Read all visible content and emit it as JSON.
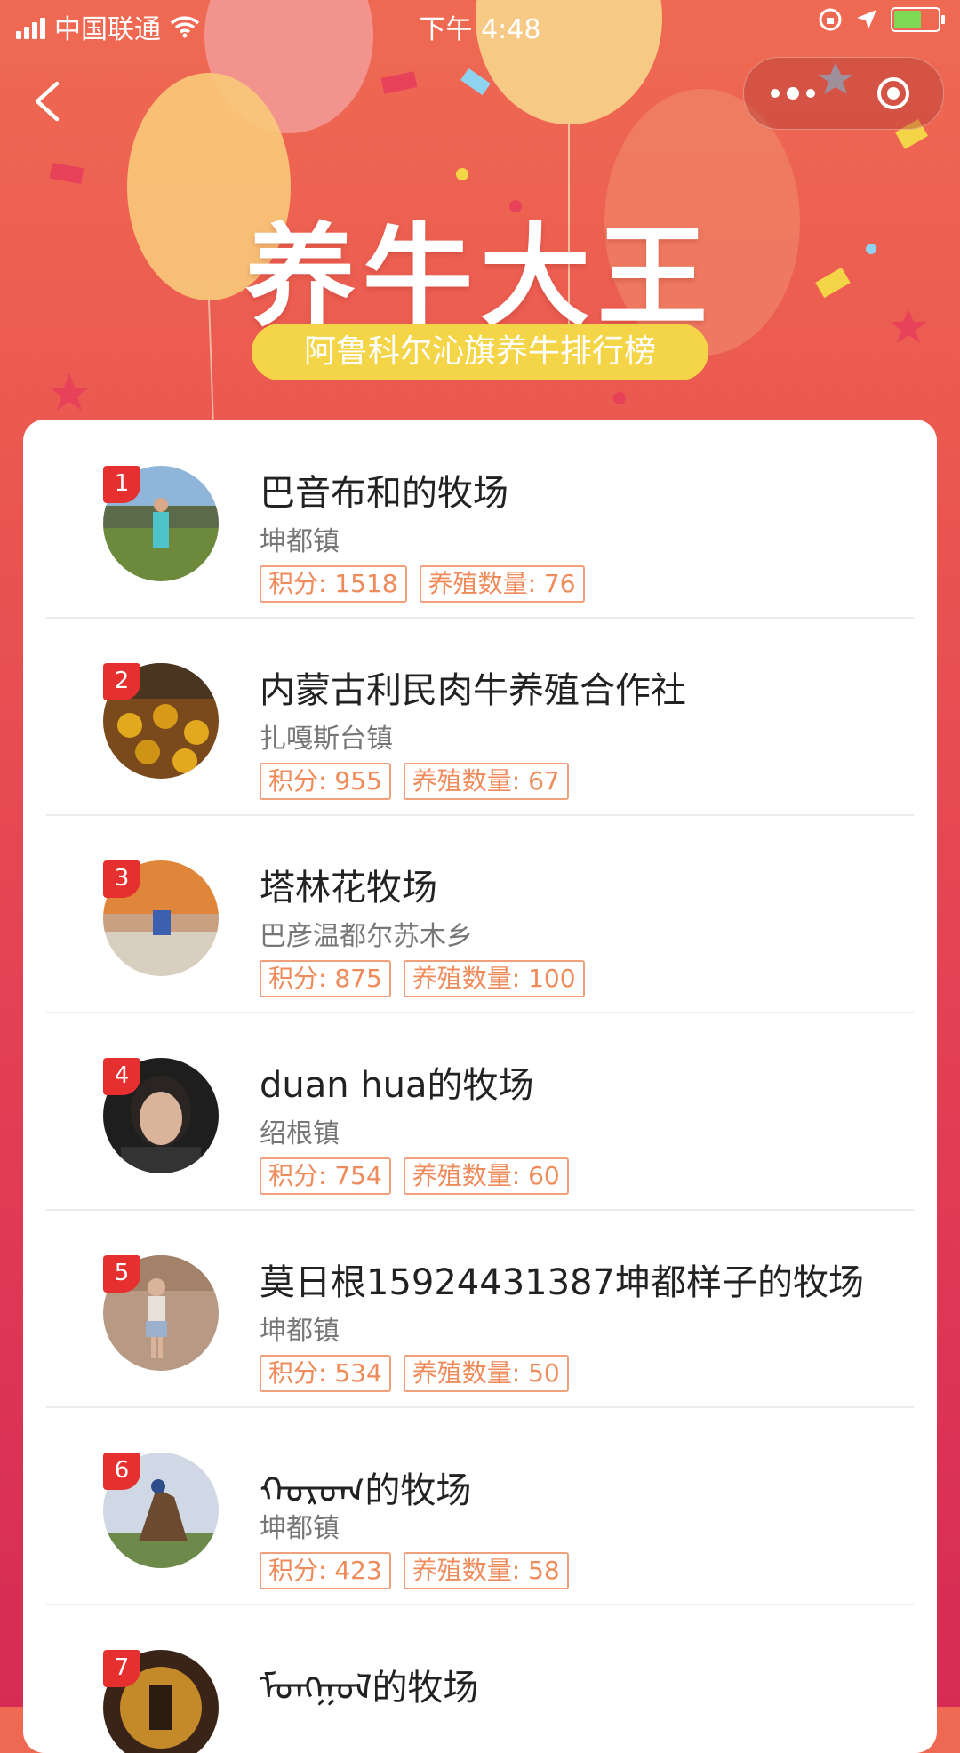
{
  "status_bar": {
    "carrier": "中国联通",
    "time": "下午 4:48"
  },
  "header": {
    "title": "养牛大王",
    "subtitle": "阿鲁科尔沁旗养牛排行榜"
  },
  "colors": {
    "primary": "#ea5550",
    "accent_yellow": "#f5d548",
    "rank_badge": "#e5302f",
    "tag_border": "#f0a07a"
  },
  "ranking": {
    "score_label": "积分",
    "count_label": "养殖数量",
    "items": [
      {
        "rank": "1",
        "name": "巴音布和的牧场",
        "town": "坤都镇",
        "score": "积分: 1518",
        "count": "养殖数量: 76"
      },
      {
        "rank": "2",
        "name": "内蒙古利民肉牛养殖合作社",
        "town": "扎嘎斯台镇",
        "score": "积分: 955",
        "count": "养殖数量: 67"
      },
      {
        "rank": "3",
        "name": "塔林花牧场",
        "town": "巴彦温都尔苏木乡",
        "score": "积分: 875",
        "count": "养殖数量: 100"
      },
      {
        "rank": "4",
        "name": "duan hua的牧场",
        "town": "绍根镇",
        "score": "积分: 754",
        "count": "养殖数量: 60"
      },
      {
        "rank": "5",
        "name": "莫日根15924431387坤都样子的牧场",
        "town": "坤都镇",
        "score": "积分: 534",
        "count": "养殖数量: 50"
      },
      {
        "rank": "6",
        "name": "ᠬᠣᠷᠣᠭ的牧场",
        "town": "坤都镇",
        "score": "积分: 423",
        "count": "养殖数量: 58"
      },
      {
        "rank": "7",
        "name": "ᠮᠣᠩᠭᠣᠯ的牧场",
        "town": "",
        "score": "",
        "count": ""
      }
    ]
  }
}
